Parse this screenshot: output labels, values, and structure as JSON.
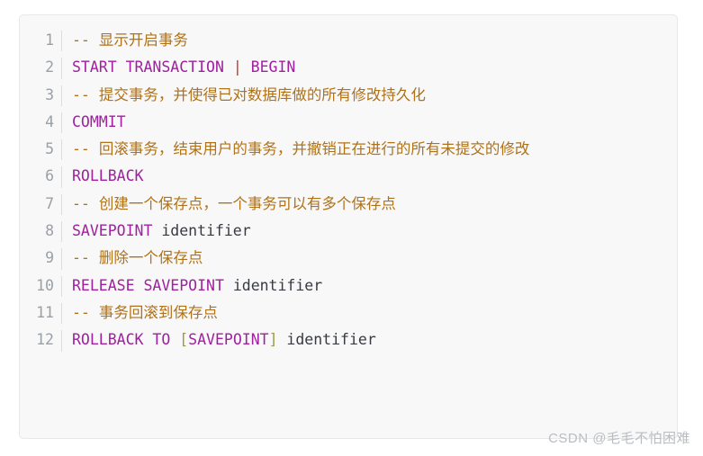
{
  "code_block": {
    "language": "sql",
    "background_color": "#f8f8f8",
    "border_color": "#e6e8eb",
    "colors": {
      "comment": "#b07219",
      "keyword": "#a020a0",
      "operator": "#c0392b",
      "bracket": "#9a9a4a",
      "plain": "#383a42",
      "line_number": "#9aa0a6"
    },
    "lines": [
      {
        "number": "1",
        "tokens": [
          {
            "type": "comment",
            "text": "-- "
          },
          {
            "type": "comment",
            "text": "显示开启事务",
            "cjk": true
          }
        ]
      },
      {
        "number": "2",
        "tokens": [
          {
            "type": "keyword",
            "text": "START TRANSACTION "
          },
          {
            "type": "operator",
            "text": "|"
          },
          {
            "type": "keyword",
            "text": " BEGIN"
          }
        ]
      },
      {
        "number": "3",
        "tokens": [
          {
            "type": "comment",
            "text": "-- "
          },
          {
            "type": "comment",
            "text": "提交事务，并使得已对数据库做的所有修改持久化",
            "cjk": true
          }
        ]
      },
      {
        "number": "4",
        "tokens": [
          {
            "type": "keyword",
            "text": "COMMIT"
          }
        ]
      },
      {
        "number": "5",
        "tokens": [
          {
            "type": "comment",
            "text": "-- "
          },
          {
            "type": "comment",
            "text": "回滚事务，结束用户的事务，并撤销正在进行的所有未提交的修改",
            "cjk": true
          }
        ]
      },
      {
        "number": "6",
        "tokens": [
          {
            "type": "keyword",
            "text": "ROLLBACK"
          }
        ]
      },
      {
        "number": "7",
        "tokens": [
          {
            "type": "comment",
            "text": "-- "
          },
          {
            "type": "comment",
            "text": "创建一个保存点，一个事务可以有多个保存点",
            "cjk": true
          }
        ]
      },
      {
        "number": "8",
        "tokens": [
          {
            "type": "keyword",
            "text": "SAVEPOINT"
          },
          {
            "type": "plain",
            "text": " identifier"
          }
        ]
      },
      {
        "number": "9",
        "tokens": [
          {
            "type": "comment",
            "text": "-- "
          },
          {
            "type": "comment",
            "text": "删除一个保存点",
            "cjk": true
          }
        ]
      },
      {
        "number": "10",
        "tokens": [
          {
            "type": "keyword",
            "text": "RELEASE SAVEPOINT"
          },
          {
            "type": "plain",
            "text": " identifier"
          }
        ]
      },
      {
        "number": "11",
        "tokens": [
          {
            "type": "comment",
            "text": "-- "
          },
          {
            "type": "comment",
            "text": "事务回滚到保存点",
            "cjk": true
          }
        ]
      },
      {
        "number": "12",
        "tokens": [
          {
            "type": "keyword",
            "text": "ROLLBACK TO "
          },
          {
            "type": "bracket",
            "text": "["
          },
          {
            "type": "keyword",
            "text": "SAVEPOINT"
          },
          {
            "type": "bracket",
            "text": "]"
          },
          {
            "type": "plain",
            "text": " identifier"
          }
        ]
      }
    ]
  },
  "watermark": {
    "text": "CSDN @毛毛不怕困难",
    "color": "#b9bdc2"
  }
}
